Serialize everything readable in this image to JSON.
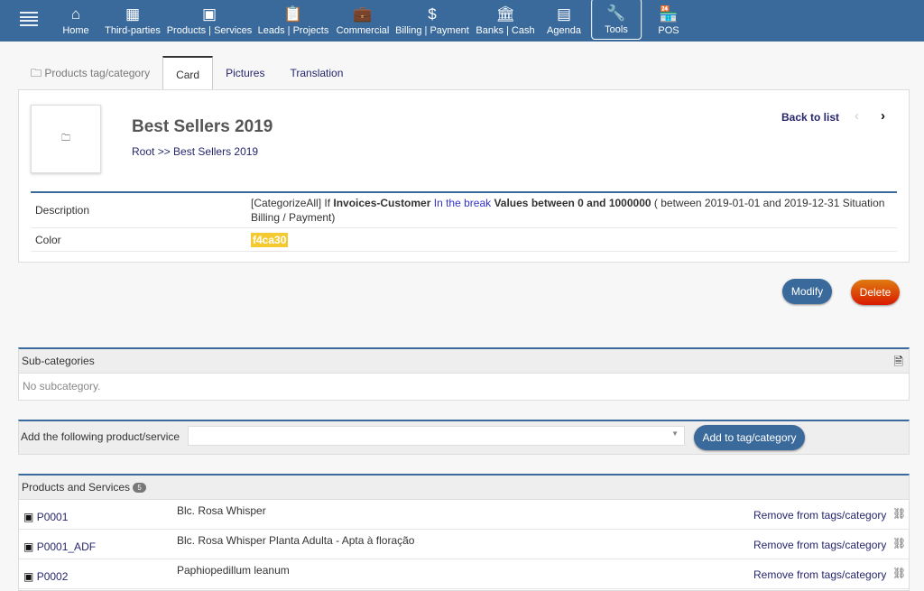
{
  "nav": {
    "items": [
      {
        "label": "Home",
        "icon": "home-icon",
        "glyph": "⌂"
      },
      {
        "label": "Third-parties",
        "icon": "building-icon",
        "glyph": "▦"
      },
      {
        "label": "Products | Services",
        "icon": "image-icon",
        "glyph": "▣"
      },
      {
        "label": "Leads | Projects",
        "icon": "clipboard-icon",
        "glyph": "📋"
      },
      {
        "label": "Commercial",
        "icon": "briefcase-icon",
        "glyph": "💼"
      },
      {
        "label": "Billing | Payment",
        "icon": "dollar-icon",
        "glyph": "$"
      },
      {
        "label": "Banks | Cash",
        "icon": "bank-icon",
        "glyph": "🏛"
      },
      {
        "label": "Agenda",
        "icon": "calendar-icon",
        "glyph": "▤"
      },
      {
        "label": "Tools",
        "icon": "wrench-icon",
        "glyph": "🔧"
      },
      {
        "label": "POS",
        "icon": "store-icon",
        "glyph": "🏪"
      }
    ]
  },
  "tabs": [
    "Products tag/category",
    "Card",
    "Pictures",
    "Translation"
  ],
  "card": {
    "title": "Best Sellers 2019",
    "breadcrumb_root": "Root",
    "breadcrumb_sep": " >> ",
    "breadcrumb_current": "Best Sellers 2019",
    "back": "Back to list",
    "description_label": "Description",
    "desc": {
      "p1": "[CategorizeAll] If ",
      "b1": "Invoices-Customer",
      "p2": " In the break ",
      "b2": "Values between 0 and 1000000",
      "p3": " ( between 2019-01-01 and 2019-12-31 Situation Billing / Payment)"
    },
    "color_label": "Color",
    "color_value": "f4ca30"
  },
  "actions": {
    "modify": "Modify",
    "delete": "Delete"
  },
  "subcategories": {
    "title": "Sub-categories",
    "empty": "No subcategory."
  },
  "add": {
    "label": "Add the following product/service",
    "value": "",
    "button": "Add to tag/category"
  },
  "products": {
    "title": "Products and Services",
    "count": "5",
    "remove_label": "Remove from tags/category",
    "rows": [
      {
        "ref": "P0001",
        "label": "Blc. Rosa Whisper"
      },
      {
        "ref": "P0001_ADF",
        "label": "Blc. Rosa Whisper Planta Adulta - Apta à floração"
      },
      {
        "ref": "P0002",
        "label": "Paphiopedillum leanum"
      }
    ]
  }
}
